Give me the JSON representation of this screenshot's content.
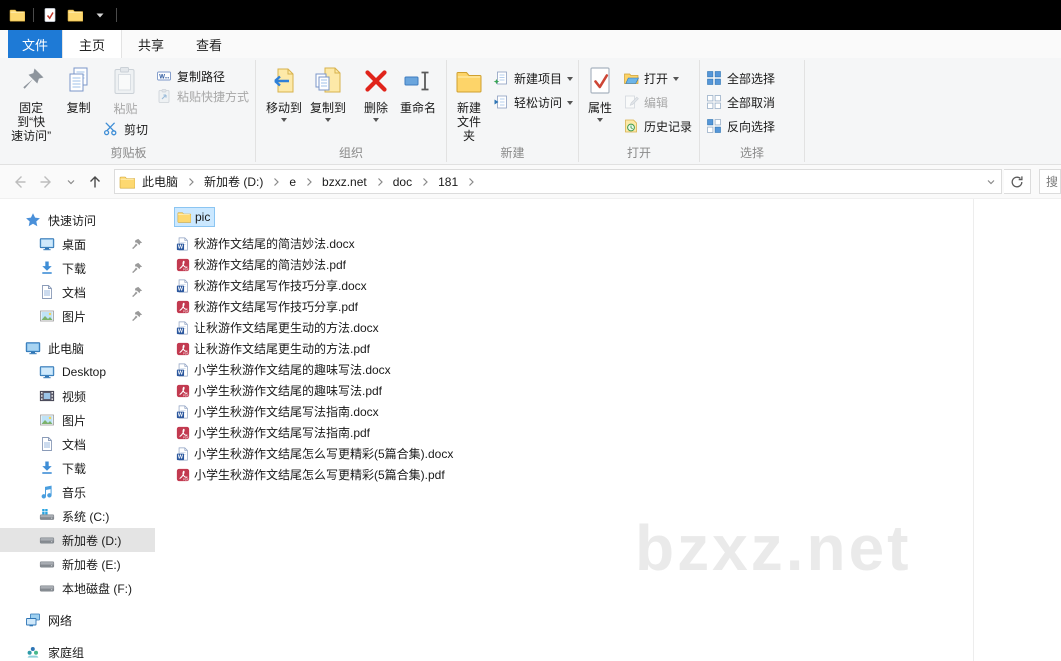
{
  "menu": {
    "file": "文件",
    "tabs": [
      "主页",
      "共享",
      "查看"
    ]
  },
  "ribbon": {
    "clipboard": {
      "label": "剪贴板",
      "pin": "固定到“快\n速访问”",
      "copy": "复制",
      "paste": "粘贴",
      "cut": "剪切",
      "copy_path": "复制路径",
      "paste_shortcut": "粘贴快捷方式"
    },
    "organize": {
      "label": "组织",
      "move_to": "移动到",
      "copy_to": "复制到",
      "delete": "删除",
      "rename": "重命名"
    },
    "new": {
      "label": "新建",
      "new_folder": "新建\n文件夹",
      "new_item": "新建项目",
      "easy_access": "轻松访问"
    },
    "open": {
      "label": "打开",
      "properties": "属性",
      "open": "打开",
      "edit": "编辑",
      "history": "历史记录"
    },
    "select": {
      "label": "选择",
      "select_all": "全部选择",
      "select_none": "全部取消",
      "invert": "反向选择"
    }
  },
  "addressbar": {
    "crumbs": [
      "此电脑",
      "新加卷 (D:)",
      "e",
      "bzxz.net",
      "doc",
      "181"
    ],
    "search_hint": "搜"
  },
  "sidebar": {
    "sections": [
      {
        "label": "快速访问",
        "icon": "star-icon",
        "children": [
          {
            "label": "桌面",
            "icon": "monitor-icon",
            "pinned": true
          },
          {
            "label": "下载",
            "icon": "download-icon",
            "pinned": true
          },
          {
            "label": "文档",
            "icon": "document-icon",
            "pinned": true
          },
          {
            "label": "图片",
            "icon": "picture-icon",
            "pinned": true
          }
        ]
      },
      {
        "label": "此电脑",
        "icon": "computer-icon",
        "children": [
          {
            "label": "Desktop",
            "icon": "monitor-icon"
          },
          {
            "label": "视频",
            "icon": "video-icon"
          },
          {
            "label": "图片",
            "icon": "picture-icon"
          },
          {
            "label": "文档",
            "icon": "document-icon"
          },
          {
            "label": "下载",
            "icon": "download-icon"
          },
          {
            "label": "音乐",
            "icon": "music-icon"
          },
          {
            "label": "系统 (C:)",
            "icon": "system-drive-icon"
          },
          {
            "label": "新加卷 (D:)",
            "icon": "drive-icon",
            "selected": true
          },
          {
            "label": "新加卷 (E:)",
            "icon": "drive-icon"
          },
          {
            "label": "本地磁盘 (F:)",
            "icon": "drive-icon"
          }
        ]
      },
      {
        "label": "网络",
        "icon": "network-icon",
        "children": []
      },
      {
        "label": "家庭组",
        "icon": "homegroup-icon",
        "children": []
      }
    ]
  },
  "files": {
    "folder": {
      "name": "pic",
      "selected": true
    },
    "items": [
      {
        "name": "秋游作文结尾的简洁妙法.docx",
        "type": "word"
      },
      {
        "name": "秋游作文结尾的简洁妙法.pdf",
        "type": "pdf"
      },
      {
        "name": "秋游作文结尾写作技巧分享.docx",
        "type": "word"
      },
      {
        "name": "秋游作文结尾写作技巧分享.pdf",
        "type": "pdf"
      },
      {
        "name": "让秋游作文结尾更生动的方法.docx",
        "type": "word"
      },
      {
        "name": "让秋游作文结尾更生动的方法.pdf",
        "type": "pdf"
      },
      {
        "name": "小学生秋游作文结尾的趣味写法.docx",
        "type": "word"
      },
      {
        "name": "小学生秋游作文结尾的趣味写法.pdf",
        "type": "pdf"
      },
      {
        "name": "小学生秋游作文结尾写法指南.docx",
        "type": "word"
      },
      {
        "name": "小学生秋游作文结尾写法指南.pdf",
        "type": "pdf"
      },
      {
        "name": "小学生秋游作文结尾怎么写更精彩(5篇合集).docx",
        "type": "word"
      },
      {
        "name": "小学生秋游作文结尾怎么写更精彩(5篇合集).pdf",
        "type": "pdf"
      }
    ]
  },
  "watermark": "bzxz.net",
  "colors": {
    "accent_blue": "#1e7ad6",
    "selection_blue": "#cbe8ff",
    "pdf_red": "#c23a50",
    "word_blue": "#2a569d",
    "folder_yellow": "#fdd870"
  }
}
